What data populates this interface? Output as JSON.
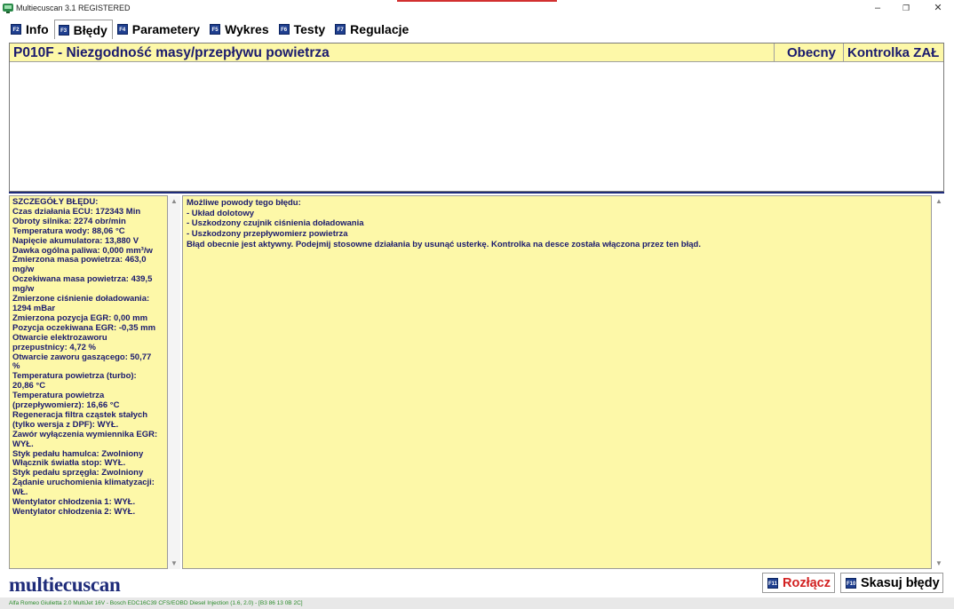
{
  "window": {
    "title": "Multiecuscan 3.1 REGISTERED",
    "min_glyph": "–",
    "max_glyph": "❐",
    "close_glyph": "✕"
  },
  "tabs": [
    {
      "key": "F2",
      "label": "Info",
      "active": false
    },
    {
      "key": "F3",
      "label": "Błędy",
      "active": true
    },
    {
      "key": "F4",
      "label": "Parametery",
      "active": false
    },
    {
      "key": "F5",
      "label": "Wykres",
      "active": false
    },
    {
      "key": "F6",
      "label": "Testy",
      "active": false
    },
    {
      "key": "F7",
      "label": "Regulacje",
      "active": false
    }
  ],
  "error_list": {
    "code_text": "P010F - Niezgodność masy/przepływu powietrza",
    "status_present": "Obecny",
    "status_mil": "Kontrolka ZAŁ"
  },
  "details": {
    "lines": [
      "SZCZEGÓŁY BŁĘDU:",
      "Czas działania ECU: 172343 Min",
      "Obroty silnika: 2274 obr/min",
      "Temperatura wody: 88,06 °C",
      "Napięcie akumulatora: 13,880 V",
      "Dawka ogólna paliwa: 0,000 mm³/w",
      "Zmierzona masa powietrza: 463,0",
      "mg/w",
      "Oczekiwana masa powietrza: 439,5",
      "mg/w",
      "Zmierzone ciśnienie doładowania:",
      "1294 mBar",
      "Zmierzona pozycja EGR: 0,00 mm",
      "Pozycja oczekiwana EGR: -0,35 mm",
      "Otwarcie elektrozaworu",
      "przepustnicy: 4,72 %",
      "Otwarcie zaworu gaszącego: 50,77",
      "%",
      "Temperatura powietrza (turbo):",
      "20,86 °C",
      "Temperatura powietrza",
      "(przepływomierz): 16,66 °C",
      "Regeneracja filtra cząstek stałych",
      "(tylko wersja z DPF): WYŁ.",
      "Zawór wyłączenia wymiennika EGR:",
      "WYŁ.",
      "Styk pedału hamulca: Zwolniony",
      "Włącznik światła stop: WYŁ.",
      "Styk pedału sprzęgła: Zwolniony",
      "Żądanie uruchomienia klimatyzacji:",
      "WŁ.",
      "Wentylator chłodzenia 1: WYŁ.",
      "Wentylator chłodzenia 2: WYŁ."
    ]
  },
  "causes": {
    "lines": [
      "Możliwe powody tego błędu:",
      "- Układ dolotowy",
      "- Uszkodzony czujnik ciśnienia doładowania",
      "- Uszkodzony przepływomierz powietrza",
      "Błąd obecnie jest aktywny. Podejmij stosowne działania by usunąć usterkę. Kontrolka na desce została włączona przez ten błąd."
    ]
  },
  "footer": {
    "logo": "multiecuscan",
    "disconnect": {
      "key": "F11",
      "label": "Rozłącz"
    },
    "clear": {
      "key": "F10",
      "label": "Skasuj błędy"
    },
    "status": "Alfa Romeo Giulietta 2.0 MultiJet 16V - Bosch EDC16C39 CFS/EOBD Diesel Injection (1.6, 2.0) - [B3 86 13 0B 2C]"
  },
  "colors": {
    "panel_yellow": "#fdf8a8",
    "text_navy": "#1a1a6e",
    "accent_red": "#d22020",
    "fkey_blue": "#1f3f8f"
  }
}
